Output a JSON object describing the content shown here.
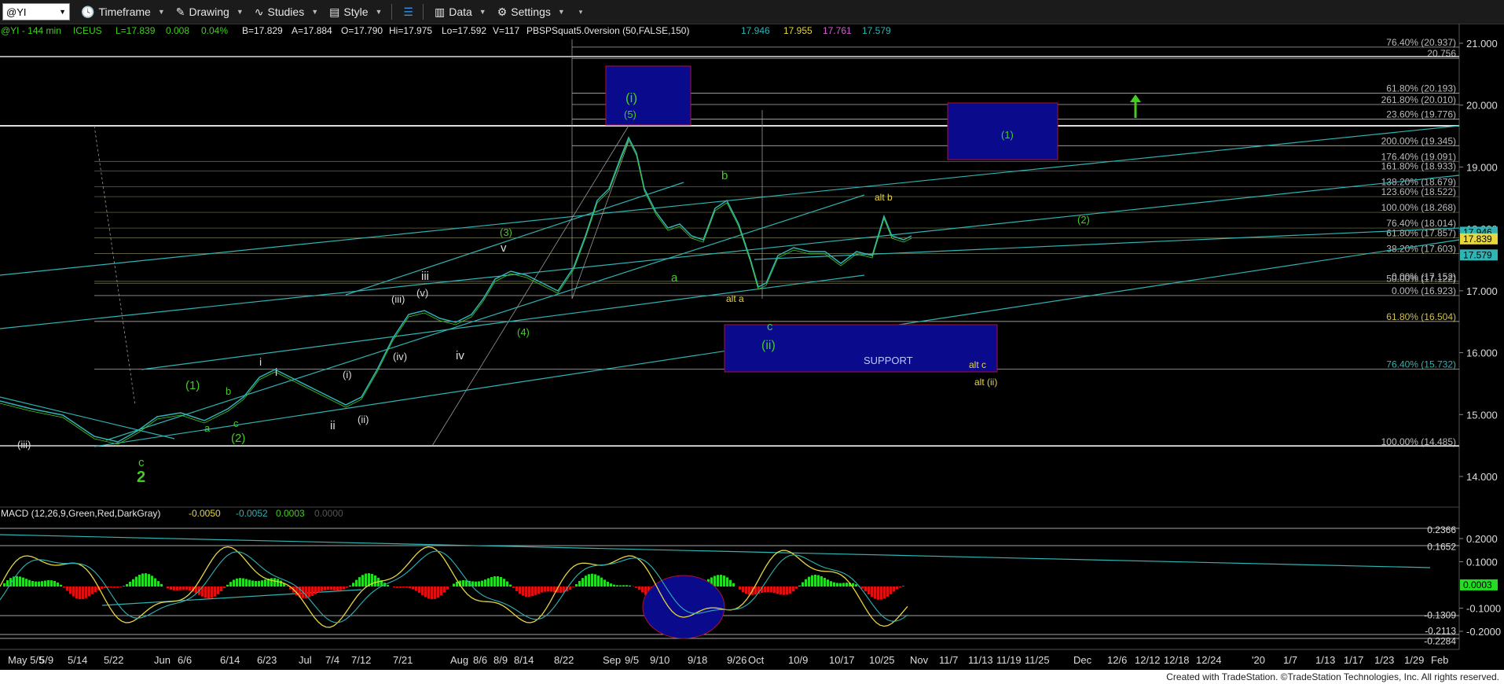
{
  "toolbar": {
    "symbol": "@YI",
    "timeframe": "Timeframe",
    "drawing": "Drawing",
    "studies": "Studies",
    "style": "Style",
    "data": "Data",
    "settings": "Settings"
  },
  "header": {
    "symbol": "@YI - 144 min",
    "exchange": "ICEUS",
    "last": "L=17.839",
    "change": "0.008",
    "pct": "0.04%",
    "bid": "B=17.829",
    "ask": "A=17.884",
    "open": "O=17.790",
    "high": "Hi=17.975",
    "low": "Lo=17.592",
    "volume": "V=117",
    "study": "PBSPSquat5.0version (50,FALSE,150)",
    "study_vals": [
      "17.946",
      "17.955",
      "17.761",
      "17.579"
    ]
  },
  "macd_header": {
    "label": "MACD (12,26,9,Green,Red,DarkGray)",
    "vals": [
      "-0.0050",
      "-0.0052",
      "0.0003",
      "0.0000"
    ]
  },
  "footer": "Created with TradeStation. ©TradeStation Technologies, Inc. All rights reserved.",
  "colors": {
    "bg": "#000000",
    "cyan": "#2fb3b3",
    "green": "#44cc22",
    "yellow": "#e6d640",
    "box": "#0a0a8c"
  },
  "chart_data": {
    "type": "line",
    "price_axis": {
      "ticks": [
        "21.000",
        "20.000",
        "19.000",
        "18.000",
        "17.000",
        "16.000",
        "15.000",
        "14.000"
      ]
    },
    "price_badges": [
      "17.946",
      "17.839",
      "17.579"
    ],
    "macd_axis": {
      "ticks": [
        "0.2000",
        "0.1000",
        "-0.1000",
        "-0.2000"
      ]
    },
    "macd_badges": [
      "0.2366",
      "0.1652",
      "0.0003",
      "-0.1309",
      "-0.2113",
      "-0.2284"
    ],
    "x_labels": [
      "May 5/5",
      "5/9",
      "5/14",
      "5/22",
      "Jun",
      "6/6",
      "6/14",
      "6/23",
      "Jul",
      "7/4",
      "7/12",
      "7/21",
      "Aug",
      "8/6",
      "8/9",
      "8/14",
      "8/22",
      "Sep",
      "9/5",
      "9/10",
      "9/18",
      "9/26",
      "Oct",
      "10/9",
      "10/17",
      "10/25",
      "Nov",
      "11/7",
      "11/13",
      "11/19",
      "11/25",
      "Dec",
      "12/6",
      "12/12",
      "12/18",
      "12/24",
      "'20",
      "1/7",
      "1/13",
      "1/17",
      "1/23",
      "1/29",
      "Feb"
    ],
    "fib_levels": [
      "76.40% (20.937)",
      "20.756",
      "61.80% (20.193)",
      "261.80% (20.010)",
      "23.60% (19.776)",
      "200.00% (19.345)",
      "176.40% (19.091)",
      "161.80% (18.933)",
      "138.20% (18.679)",
      "123.60% (18.522)",
      "100.00% (18.268)",
      "76.40% (18.014)",
      "61.80% (17.857)",
      "38.20% (17.603)",
      "0.00% (17.152)",
      "50.00% (17.122)",
      "0.00% (16.923)",
      "61.80% (16.504)",
      "76.40% (15.732)",
      "100.00% (14.485)"
    ],
    "wave_labels": {
      "green": [
        "(i)",
        "(5)",
        "b",
        "(1)",
        "(2)",
        "(3)",
        "(4)",
        "a",
        "c",
        "(ii)",
        "(1)",
        "(2)",
        "c",
        "2"
      ],
      "white": [
        "iii",
        "(v)",
        "(iii)",
        "(iv)",
        "iv",
        "v",
        "i",
        "i",
        "(i)",
        "ii",
        "(ii)",
        "(iii)",
        "b",
        "a",
        "c"
      ],
      "yellow": [
        "alt b",
        "alt a",
        "alt c",
        "alt (ii)"
      ]
    },
    "support_label": "SUPPORT"
  }
}
